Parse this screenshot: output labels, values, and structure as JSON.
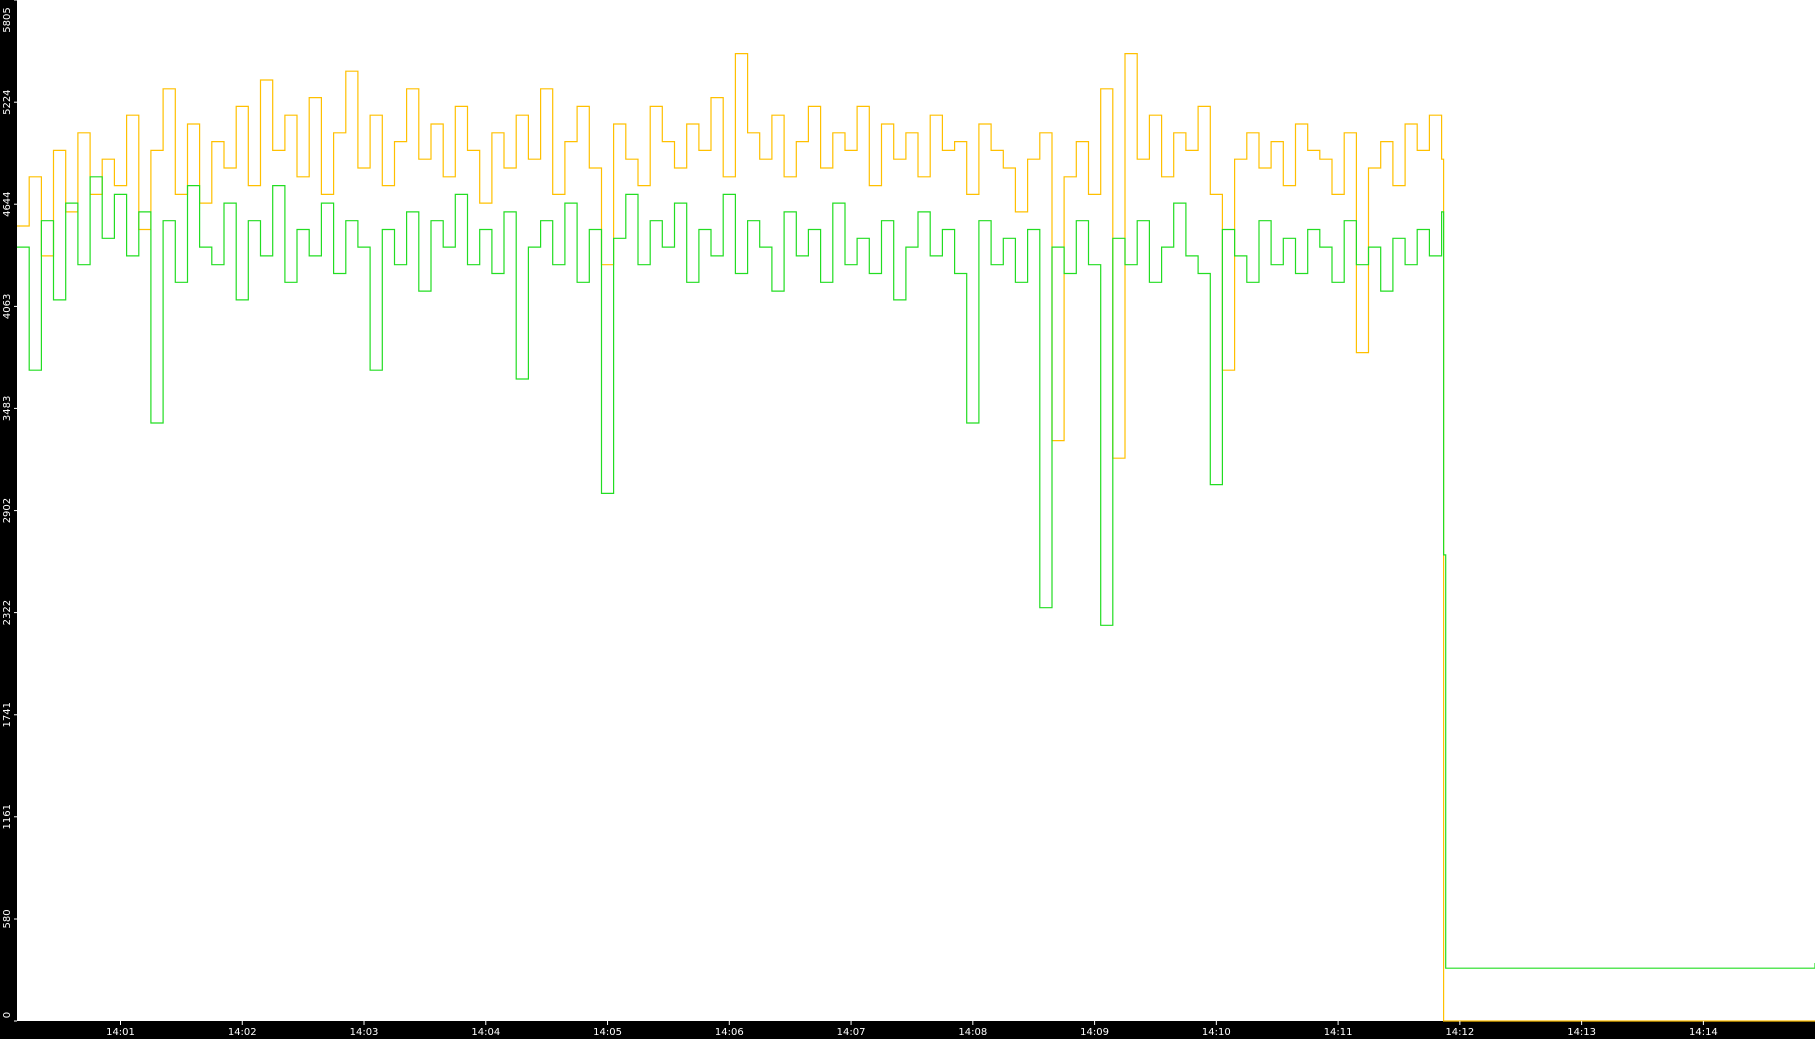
{
  "chart_data": {
    "type": "line",
    "title": "",
    "xlabel": "",
    "ylabel": "",
    "background": "#ffffff",
    "frame_color": "#000000",
    "label_color": "#ffffff",
    "ylim": [
      0,
      5805
    ],
    "yticks": [
      {
        "value": 0,
        "label": "0"
      },
      {
        "value": 580,
        "label": "580"
      },
      {
        "value": 1161,
        "label": "1161"
      },
      {
        "value": 1741,
        "label": "1741"
      },
      {
        "value": 2322,
        "label": "2322"
      },
      {
        "value": 2902,
        "label": "2902"
      },
      {
        "value": 3483,
        "label": "3483"
      },
      {
        "value": 4063,
        "label": "4063"
      },
      {
        "value": 4644,
        "label": "4644"
      },
      {
        "value": 5224,
        "label": "5224"
      },
      {
        "value": 5805,
        "label": "5805"
      }
    ],
    "xlim": [
      "14:00:09",
      "14:14:55"
    ],
    "xticks": [
      "14:01",
      "14:02",
      "14:03",
      "14:04",
      "14:05",
      "14:06",
      "14:07",
      "14:08",
      "14:09",
      "14:10",
      "14:11",
      "14:12",
      "14:13",
      "14:14"
    ],
    "series": [
      {
        "color": "#ffc000",
        "x": [
          "14:00:09",
          "14:00:15",
          "14:00:21",
          "14:00:27",
          "14:00:33",
          "14:00:39",
          "14:00:45",
          "14:00:51",
          "14:00:57",
          "14:01:03",
          "14:01:09",
          "14:01:15",
          "14:01:21",
          "14:01:27",
          "14:01:33",
          "14:01:39",
          "14:01:45",
          "14:01:51",
          "14:01:57",
          "14:02:03",
          "14:02:09",
          "14:02:15",
          "14:02:21",
          "14:02:27",
          "14:02:33",
          "14:02:39",
          "14:02:45",
          "14:02:51",
          "14:02:57",
          "14:03:03",
          "14:03:09",
          "14:03:15",
          "14:03:21",
          "14:03:27",
          "14:03:33",
          "14:03:39",
          "14:03:45",
          "14:03:51",
          "14:03:57",
          "14:04:03",
          "14:04:09",
          "14:04:15",
          "14:04:21",
          "14:04:27",
          "14:04:33",
          "14:04:39",
          "14:04:45",
          "14:04:51",
          "14:04:57",
          "14:05:03",
          "14:05:09",
          "14:05:15",
          "14:05:21",
          "14:05:27",
          "14:05:33",
          "14:05:39",
          "14:05:45",
          "14:05:51",
          "14:05:57",
          "14:06:03",
          "14:06:09",
          "14:06:15",
          "14:06:21",
          "14:06:27",
          "14:06:33",
          "14:06:39",
          "14:06:45",
          "14:06:51",
          "14:06:57",
          "14:07:03",
          "14:07:09",
          "14:07:15",
          "14:07:21",
          "14:07:27",
          "14:07:33",
          "14:07:39",
          "14:07:45",
          "14:07:51",
          "14:07:57",
          "14:08:03",
          "14:08:09",
          "14:08:15",
          "14:08:21",
          "14:08:27",
          "14:08:33",
          "14:08:39",
          "14:08:45",
          "14:08:51",
          "14:08:57",
          "14:09:03",
          "14:09:09",
          "14:09:15",
          "14:09:21",
          "14:09:27",
          "14:09:33",
          "14:09:39",
          "14:09:45",
          "14:09:51",
          "14:09:57",
          "14:10:03",
          "14:10:09",
          "14:10:15",
          "14:10:21",
          "14:10:27",
          "14:10:33",
          "14:10:39",
          "14:10:45",
          "14:10:51",
          "14:10:57",
          "14:11:03",
          "14:11:09",
          "14:11:15",
          "14:11:21",
          "14:11:27",
          "14:11:33",
          "14:11:39",
          "14:11:45",
          "14:11:51",
          "14:11:52",
          "14:14:55"
        ],
        "y": [
          4520,
          4800,
          4350,
          4950,
          4600,
          5050,
          4700,
          4900,
          4750,
          5150,
          4500,
          4950,
          5300,
          4700,
          5100,
          4650,
          5000,
          4850,
          5200,
          4750,
          5350,
          4950,
          5150,
          4800,
          5250,
          4700,
          5050,
          5400,
          4850,
          5150,
          4750,
          5000,
          5300,
          4900,
          5100,
          4800,
          5200,
          4950,
          4650,
          5050,
          4850,
          5150,
          4900,
          5300,
          4700,
          5000,
          5200,
          4850,
          4300,
          5100,
          4900,
          4750,
          5200,
          5000,
          4850,
          5100,
          4950,
          5250,
          4800,
          5500,
          5050,
          4900,
          5150,
          4800,
          5000,
          5200,
          4850,
          5050,
          4950,
          5200,
          4750,
          5100,
          4900,
          5050,
          4800,
          5150,
          4950,
          5000,
          4700,
          5100,
          4950,
          4850,
          4600,
          4900,
          5050,
          3300,
          4800,
          5000,
          4700,
          5300,
          3200,
          5500,
          4900,
          5150,
          4800,
          5050,
          4950,
          5200,
          4700,
          3700,
          4900,
          5050,
          4850,
          5000,
          4750,
          5100,
          4950,
          4900,
          4700,
          5050,
          3800,
          4850,
          5000,
          4750,
          5100,
          4950,
          5150,
          4900,
          0,
          0
        ]
      },
      {
        "color": "#22dd22",
        "x": [
          "14:00:09",
          "14:00:15",
          "14:00:21",
          "14:00:27",
          "14:00:33",
          "14:00:39",
          "14:00:45",
          "14:00:51",
          "14:00:57",
          "14:01:03",
          "14:01:09",
          "14:01:15",
          "14:01:21",
          "14:01:27",
          "14:01:33",
          "14:01:39",
          "14:01:45",
          "14:01:51",
          "14:01:57",
          "14:02:03",
          "14:02:09",
          "14:02:15",
          "14:02:21",
          "14:02:27",
          "14:02:33",
          "14:02:39",
          "14:02:45",
          "14:02:51",
          "14:02:57",
          "14:03:03",
          "14:03:09",
          "14:03:15",
          "14:03:21",
          "14:03:27",
          "14:03:33",
          "14:03:39",
          "14:03:45",
          "14:03:51",
          "14:03:57",
          "14:04:03",
          "14:04:09",
          "14:04:15",
          "14:04:21",
          "14:04:27",
          "14:04:33",
          "14:04:39",
          "14:04:45",
          "14:04:51",
          "14:04:57",
          "14:05:03",
          "14:05:09",
          "14:05:15",
          "14:05:21",
          "14:05:27",
          "14:05:33",
          "14:05:39",
          "14:05:45",
          "14:05:51",
          "14:05:57",
          "14:06:03",
          "14:06:09",
          "14:06:15",
          "14:06:21",
          "14:06:27",
          "14:06:33",
          "14:06:39",
          "14:06:45",
          "14:06:51",
          "14:06:57",
          "14:07:03",
          "14:07:09",
          "14:07:15",
          "14:07:21",
          "14:07:27",
          "14:07:33",
          "14:07:39",
          "14:07:45",
          "14:07:51",
          "14:07:57",
          "14:08:03",
          "14:08:09",
          "14:08:15",
          "14:08:21",
          "14:08:27",
          "14:08:33",
          "14:08:39",
          "14:08:45",
          "14:08:51",
          "14:08:57",
          "14:09:03",
          "14:09:09",
          "14:09:15",
          "14:09:21",
          "14:09:27",
          "14:09:33",
          "14:09:39",
          "14:09:45",
          "14:09:51",
          "14:09:57",
          "14:10:03",
          "14:10:09",
          "14:10:15",
          "14:10:21",
          "14:10:27",
          "14:10:33",
          "14:10:39",
          "14:10:45",
          "14:10:51",
          "14:10:57",
          "14:11:03",
          "14:11:09",
          "14:11:15",
          "14:11:21",
          "14:11:27",
          "14:11:33",
          "14:11:39",
          "14:11:45",
          "14:11:51",
          "14:11:52",
          "14:11:53",
          "14:14:55"
        ],
        "y": [
          4400,
          3700,
          4550,
          4100,
          4650,
          4300,
          4800,
          4450,
          4700,
          4350,
          4600,
          3400,
          4550,
          4200,
          4750,
          4400,
          4300,
          4650,
          4100,
          4550,
          4350,
          4750,
          4200,
          4500,
          4350,
          4650,
          4250,
          4550,
          4400,
          3700,
          4500,
          4300,
          4600,
          4150,
          4550,
          4400,
          4700,
          4300,
          4500,
          4250,
          4600,
          3650,
          4400,
          4550,
          4300,
          4650,
          4200,
          4500,
          3000,
          4450,
          4700,
          4300,
          4550,
          4400,
          4650,
          4200,
          4500,
          4350,
          4700,
          4250,
          4550,
          4400,
          4150,
          4600,
          4350,
          4500,
          4200,
          4650,
          4300,
          4450,
          4250,
          4550,
          4100,
          4400,
          4600,
          4350,
          4500,
          4250,
          3400,
          4550,
          4300,
          4450,
          4200,
          4500,
          2350,
          4400,
          4250,
          4550,
          4300,
          2250,
          4450,
          4300,
          4550,
          4200,
          4400,
          4650,
          4350,
          4250,
          3050,
          4500,
          4350,
          4200,
          4550,
          4300,
          4450,
          4250,
          4500,
          4400,
          4200,
          4550,
          4300,
          4400,
          4150,
          4450,
          4300,
          4500,
          4350,
          4600,
          2650,
          300,
          330
        ]
      }
    ]
  }
}
